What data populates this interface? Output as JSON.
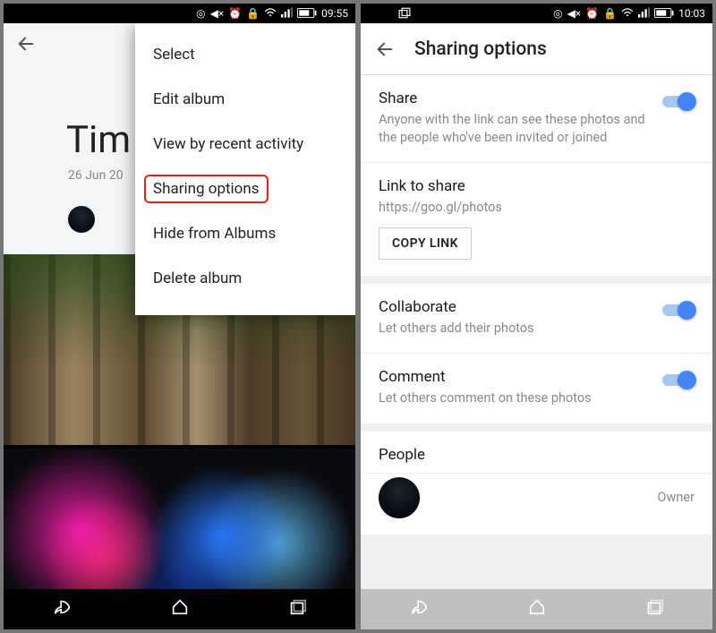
{
  "left": {
    "status": {
      "time": "09:55",
      "icons": [
        "volume-mute",
        "alarm",
        "lock",
        "wifi",
        "signal",
        "battery"
      ]
    },
    "album": {
      "title_visible": "Tim",
      "date_visible": "26 Jun 20"
    },
    "menu": {
      "items": [
        {
          "label": "Select"
        },
        {
          "label": "Edit album"
        },
        {
          "label": "View by recent activity"
        },
        {
          "label": "Sharing options",
          "highlighted": true
        },
        {
          "label": "Hide from Albums"
        },
        {
          "label": "Delete album"
        }
      ]
    }
  },
  "right": {
    "status": {
      "time": "10:03"
    },
    "header": {
      "title": "Sharing options"
    },
    "share": {
      "title": "Share",
      "desc": "Anyone with the link can see these photos and the people who've been invited or joined",
      "enabled": true
    },
    "link": {
      "title": "Link to share",
      "url": "https://goo.gl/photos",
      "copy_label": "COPY LINK"
    },
    "collaborate": {
      "title": "Collaborate",
      "desc": "Let others add their photos",
      "enabled": true
    },
    "comment": {
      "title": "Comment",
      "desc": "Let others comment on these photos",
      "enabled": true
    },
    "people": {
      "title": "People",
      "owner_label": "Owner"
    }
  },
  "colors": {
    "accent": "#4285f4",
    "highlight": "#e62117"
  }
}
